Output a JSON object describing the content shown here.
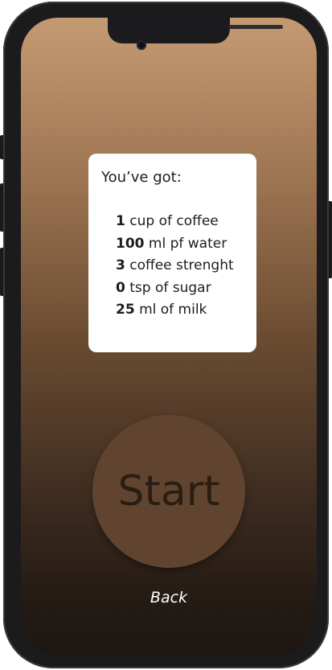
{
  "summary": {
    "title": "You’ve got:",
    "items": [
      {
        "amount": "1",
        "text": " cup of coffee"
      },
      {
        "amount": "100",
        "text": " ml pf water"
      },
      {
        "amount": "3",
        "text": " coffee strenght"
      },
      {
        "amount": "0",
        "text": " tsp of sugar"
      },
      {
        "amount": "25",
        "text": " ml of milk"
      }
    ]
  },
  "start_label": "Start",
  "back_label": "Back",
  "colors": {
    "card": "#ffffff",
    "start_button": "#604430",
    "gradient_top": "#c49a72",
    "gradient_bottom": "#1d1612"
  }
}
